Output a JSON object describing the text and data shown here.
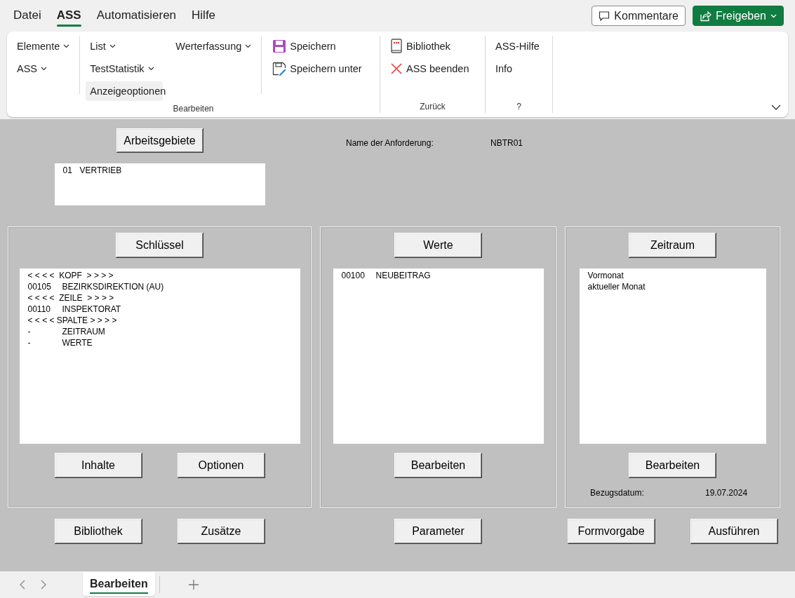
{
  "menu": [
    {
      "label": "Datei",
      "selected": false
    },
    {
      "label": "ASS",
      "selected": true
    },
    {
      "label": "Automatisieren",
      "selected": false
    },
    {
      "label": "Hilfe",
      "selected": false
    }
  ],
  "header_buttons": [
    {
      "kind": "comment",
      "label": "Kommentare"
    },
    {
      "kind": "share",
      "label": "Freigeben"
    }
  ],
  "ribbon": {
    "groups": [
      {
        "label": "Bearbeiten",
        "columns": [
          [
            {
              "kind": "dropdown",
              "label": "Elemente",
              "hovered": false
            },
            {
              "kind": "dropdown",
              "label": "ASS",
              "hovered": false
            }
          ],
          [
            {
              "kind": "dropdown",
              "label": "List",
              "hovered": false
            },
            {
              "kind": "dropdown",
              "label": "TestStatistik",
              "hovered": false
            },
            {
              "kind": "plain",
              "label": "Anzeigeoptionen",
              "hovered": true
            }
          ],
          [
            {
              "kind": "dropdown",
              "label": "Werterfassung",
              "hovered": false
            }
          ],
          [
            {
              "kind": "save",
              "label": "Speichern",
              "hovered": false
            },
            {
              "kind": "save-as",
              "label": "Speichern unter",
              "hovered": false
            }
          ]
        ]
      },
      {
        "label": "Zurück",
        "columns": [
          [
            {
              "kind": "book",
              "label": "Bibliothek",
              "hovered": false
            },
            {
              "kind": "close",
              "label": "ASS beenden",
              "hovered": false
            }
          ]
        ]
      },
      {
        "label": "?",
        "columns": [
          [
            {
              "kind": "plain",
              "label": "ASS-Hilfe",
              "hovered": false
            },
            {
              "kind": "plain",
              "label": "Info",
              "hovered": false
            }
          ]
        ]
      }
    ]
  },
  "form": {
    "workarea_button": {
      "label": "Arbeitsgebiete"
    },
    "workarea_list": [
      {
        "code": "01",
        "text": "VERTRIEB"
      }
    ],
    "request_name": {
      "label": "Name der Anforderung:",
      "value": "NBTR01"
    },
    "panels": [
      {
        "button": {
          "label": "Schlüssel"
        },
        "items": [
          {
            "text": "< < < <  KOPF  > > > >"
          },
          {
            "code": "00105",
            "text": "BEZIRKSDIREKTION (AU)"
          },
          {
            "text": "< < < <  ZEILE  > > > >"
          },
          {
            "code": "00110",
            "text": "INSPEKTORAT"
          },
          {
            "text": "< < < < SPALTE > > > >"
          },
          {
            "code": "-",
            "text": "ZEITRAUM"
          },
          {
            "code": "-",
            "text": "WERTE"
          }
        ],
        "buttons": [
          {
            "label": "Inhalte"
          },
          {
            "label": "Optionen"
          }
        ],
        "bottom_buttons": [
          {
            "label": "Bibliothek"
          },
          {
            "label": "Zusätze"
          }
        ]
      },
      {
        "button": {
          "label": "Werte"
        },
        "items": [
          {
            "code": "00100",
            "text": "NEUBEITRAG"
          }
        ],
        "buttons": [
          {
            "label": "Bearbeiten"
          }
        ],
        "bottom_buttons": [
          {
            "label": "Parameter"
          }
        ]
      },
      {
        "button": {
          "label": "Zeitraum"
        },
        "items": [
          {
            "text": "Vormonat"
          },
          {
            "text": "aktueller Monat"
          }
        ],
        "buttons": [
          {
            "label": "Bearbeiten"
          }
        ],
        "footer": {
          "label": "Bezugsdatum:",
          "value": "19.07.2024"
        },
        "bottom_buttons": [
          {
            "label": "Formvorgabe"
          },
          {
            "label": "Ausführen"
          }
        ]
      }
    ]
  },
  "sheets": [
    {
      "label": "Bearbeiten",
      "selected": true
    }
  ]
}
